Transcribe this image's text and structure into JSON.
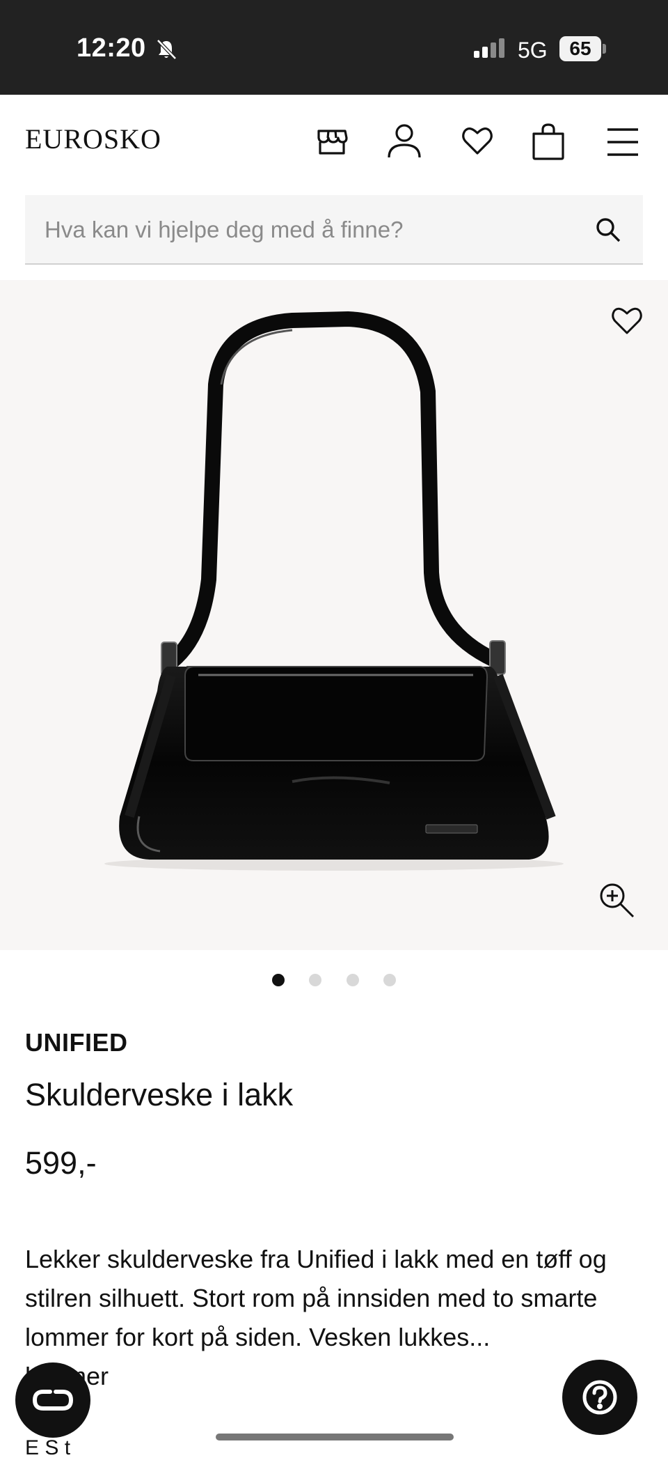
{
  "status_bar": {
    "time": "12:20",
    "network": "5G",
    "battery": "65"
  },
  "header": {
    "logo": "EUROSKO"
  },
  "search": {
    "placeholder": "Hva kan vi hjelpe deg med å finne?"
  },
  "gallery": {
    "image_count": 4,
    "active_index": 0
  },
  "product": {
    "brand": "UNIFIED",
    "name": "Skulderveske i lakk",
    "price": "599,-",
    "description": "Lekker skulderveske fra Unified i lakk med en tøff og stilren silhuett. Stort rom på innsiden med to smarte lommer for kort på siden. Vesken lukkes...",
    "description_more": "lommer",
    "next_row": "E S t"
  },
  "icons": {
    "status": [
      "bell-muted-icon",
      "signal-icon",
      "battery-icon"
    ],
    "header": [
      "store-icon",
      "account-icon",
      "wishlist-icon",
      "bag-icon",
      "menu-icon"
    ],
    "image": [
      "heart-icon",
      "zoom-in-icon"
    ],
    "floating": [
      "chat-icon",
      "help-icon"
    ]
  }
}
